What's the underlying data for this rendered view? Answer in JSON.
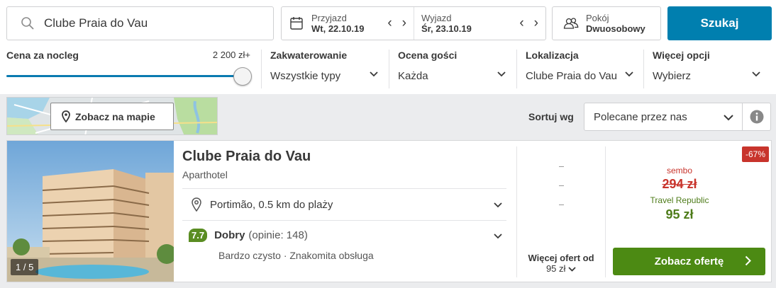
{
  "search": {
    "value": "Clube Praia do Vau"
  },
  "dates": {
    "checkin": {
      "label": "Przyjazd",
      "value": "Wt, 22.10.19"
    },
    "checkout": {
      "label": "Wyjazd",
      "value": "Śr, 23.10.19"
    }
  },
  "rooms": {
    "label": "Pokój",
    "value": "Dwuosobowy"
  },
  "search_button": "Szukaj",
  "filters": {
    "price": {
      "label": "Cena za nocleg",
      "max": "2 200 zł+",
      "level_fraction": 1.0
    },
    "accommodation": {
      "label": "Zakwaterowanie",
      "value": "Wszystkie typy"
    },
    "rating": {
      "label": "Ocena gości",
      "value": "Każda"
    },
    "location": {
      "label": "Lokalizacja",
      "value": "Clube Praia do Vau"
    },
    "more": {
      "label": "Więcej opcji",
      "value": "Wybierz"
    }
  },
  "map_button": "Zobacz na mapie",
  "sort": {
    "label": "Sortuj wg",
    "value": "Polecane przez nas"
  },
  "hotel": {
    "photo_count": "1 / 5",
    "name": "Clube Praia do Vau",
    "type": "Aparthotel",
    "location": "Portimão, 0.5 km do plaży",
    "rating": "7.7",
    "rating_word": "Dobry",
    "review_count": "(opinie: 148)",
    "tags": "Bardzo czysto · Znakomita obsługa",
    "more_offers_line1": "Więcej ofert od",
    "more_offers_line2": "95 zł",
    "discount": "-67%",
    "offer_source": "sembo",
    "old_price": "294 zł",
    "provider": "Travel Republic",
    "price": "95 zł",
    "cta": "Zobacz ofertę"
  },
  "colors": {
    "primary": "#007faf",
    "cta": "#4c8a13",
    "discount": "#c8342c",
    "rating_badge": "#5a8d22"
  }
}
